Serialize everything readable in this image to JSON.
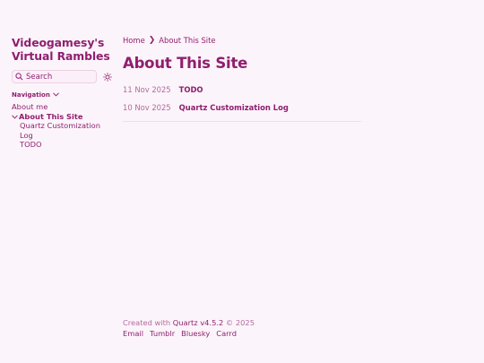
{
  "site": {
    "title": "Videogamesy's Virtual Rambles"
  },
  "search": {
    "placeholder": "Search"
  },
  "nav": {
    "header": "Navigation",
    "items": [
      {
        "label": "About me"
      },
      {
        "label": "About This Site",
        "children": [
          {
            "label": "Quartz Customization Log"
          },
          {
            "label": "TODO"
          }
        ]
      }
    ]
  },
  "breadcrumb": {
    "home": "Home",
    "separator": "❯",
    "current": "About This Site"
  },
  "page": {
    "title": "About This Site",
    "posts": [
      {
        "date": "11 Nov 2025",
        "title": "TODO"
      },
      {
        "date": "10 Nov 2025",
        "title": "Quartz Customization Log"
      }
    ]
  },
  "footer": {
    "created_with": "Created with",
    "generator": "Quartz v4.5.2",
    "copyright": "© 2025",
    "links": [
      "Email",
      "Tumblr",
      "Bluesky",
      "Carrd"
    ]
  },
  "colors": {
    "accent": "#8f1f6e",
    "muted": "#b16a9c",
    "background": "#fcf4fb"
  },
  "icons": {
    "search": "search-icon",
    "theme": "sun-icon",
    "chevron": "chevron-down-icon"
  }
}
